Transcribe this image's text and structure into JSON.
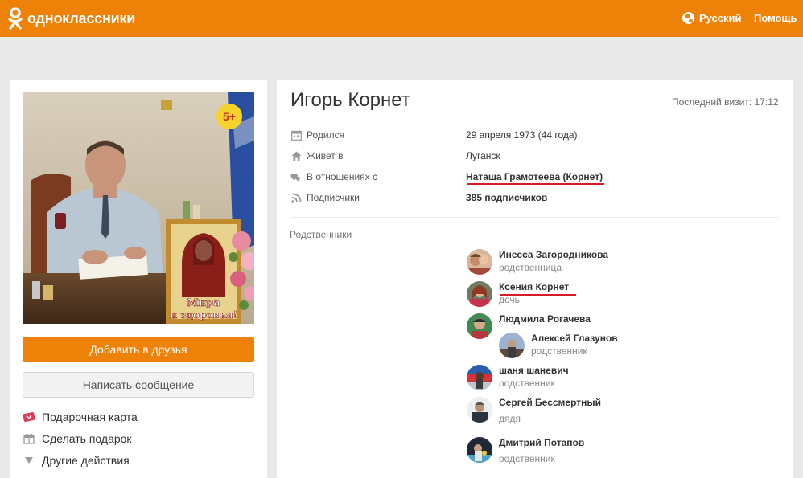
{
  "header": {
    "logo_text": "одноклассники",
    "language": "Русский",
    "help": "Помощь"
  },
  "profile": {
    "name": "Игорь Корнет",
    "last_visit": "Последний визит: 17:12",
    "age_badge": "5+",
    "photo_caption_line1": "Мира",
    "photo_caption_line2": "и здоровья!",
    "info": [
      {
        "label": "Родился",
        "value": "29 апреля 1973 (44 года)",
        "icon": "calendar-icon"
      },
      {
        "label": "Живет в",
        "value": "Луганск",
        "icon": "home-icon"
      },
      {
        "label": "В отношениях с",
        "value": "Наташа Грамотеева (Корнет)",
        "icon": "hearts-icon"
      },
      {
        "label": "Подписчики",
        "value": "385 подписчиков",
        "icon": "rss-icon"
      }
    ]
  },
  "actions": {
    "add_friend": "Добавить в друзья",
    "write_message": "Написать сообщение",
    "gift_card": "Подарочная карта",
    "make_gift": "Сделать подарок",
    "other_actions": "Другие действия"
  },
  "relatives": {
    "title": "Родственники",
    "items": [
      {
        "name": "Инесса Загородникова",
        "role": "родственница"
      },
      {
        "name": "Ксения Корнет",
        "role": "дочь"
      },
      {
        "name": "Людмила Рогачева",
        "role": ""
      },
      {
        "name": "Алексей Глазунов",
        "role": "родственник"
      },
      {
        "name": "шаня шаневич",
        "role": "родственник"
      },
      {
        "name": "Сергей Бессмертный",
        "role": "дядя"
      },
      {
        "name": "Дмитрий Потапов",
        "role": "родственник"
      }
    ]
  },
  "colors": {
    "brand_orange": "#ee8208",
    "annotation_red": "#d71b26"
  }
}
